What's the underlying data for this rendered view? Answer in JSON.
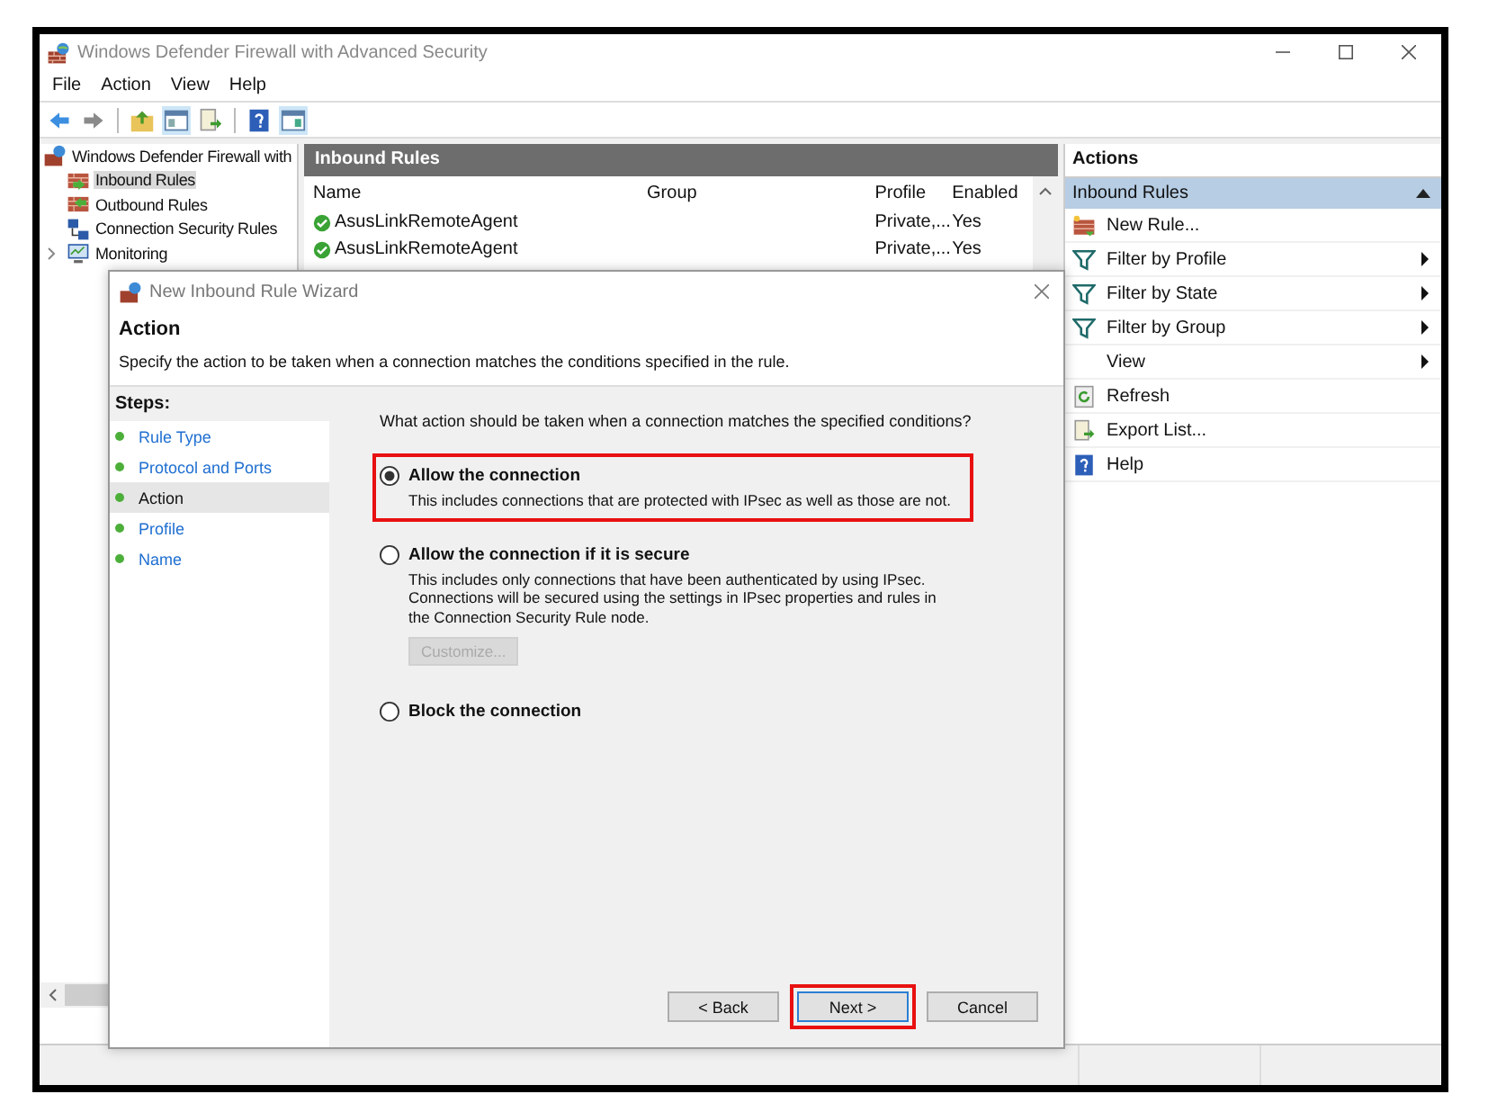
{
  "window": {
    "title": "Windows Defender Firewall with Advanced Security"
  },
  "menu": [
    "File",
    "Action",
    "View",
    "Help"
  ],
  "tree": {
    "label": "Windows Defender Firewall with",
    "children": [
      {
        "label": "Inbound Rules",
        "kind": "inbound",
        "selected": true
      },
      {
        "label": "Outbound Rules",
        "kind": "outbound",
        "selected": false
      },
      {
        "label": "Connection Security Rules",
        "kind": "security",
        "selected": false
      },
      {
        "label": "Monitoring",
        "kind": "monitor",
        "selected": false,
        "expanded": false
      }
    ]
  },
  "rules": {
    "title": "Inbound Rules",
    "columns": [
      "Name",
      "Group",
      "Profile",
      "Enabled"
    ],
    "rows": [
      {
        "name": "AsusLinkRemoteAgent",
        "profile": "Private,...",
        "enabled": "Yes"
      },
      {
        "name": "AsusLinkRemoteAgent",
        "profile": "Private,...",
        "enabled": "Yes"
      }
    ]
  },
  "actions": {
    "title": "Actions",
    "group": {
      "label": "Inbound Rules",
      "expanded": true
    },
    "items": [
      {
        "label": "New Rule...",
        "kind": "new-rule",
        "submenu": false
      },
      {
        "label": "Filter by Profile",
        "kind": "filter",
        "submenu": true
      },
      {
        "label": "Filter by State",
        "kind": "filter",
        "submenu": true
      },
      {
        "label": "Filter by Group",
        "kind": "filter",
        "submenu": true
      },
      {
        "label": "View",
        "kind": "none",
        "submenu": true
      },
      {
        "label": "Refresh",
        "kind": "refresh",
        "submenu": false
      },
      {
        "label": "Export List...",
        "kind": "export",
        "submenu": false
      },
      {
        "label": "Help",
        "kind": "help",
        "submenu": false
      }
    ]
  },
  "wizard": {
    "title": "New Inbound Rule Wizard",
    "heading": "Action",
    "description": "Specify the action to be taken when a connection matches the conditions specified in the rule.",
    "steps_label": "Steps:",
    "steps": [
      {
        "label": "Rule Type",
        "selected": false
      },
      {
        "label": "Protocol and Ports",
        "selected": false
      },
      {
        "label": "Action",
        "selected": true
      },
      {
        "label": "Profile",
        "selected": false
      },
      {
        "label": "Name",
        "selected": false
      }
    ],
    "question": "What action should be taken when a connection matches the specified conditions?",
    "options": [
      {
        "label": "Allow the connection",
        "description": "This includes connections that are protected with IPsec as well as those are not.",
        "selected": true,
        "highlighted": true
      },
      {
        "label": "Allow the connection if it is secure",
        "description": "This includes only connections that have been authenticated by using IPsec.  Connections will be secured using the settings in IPsec properties and rules in the Connection Security Rule node.",
        "selected": false,
        "highlighted": false,
        "button": {
          "label": "Customize...",
          "disabled": true
        }
      },
      {
        "label": "Block the connection",
        "selected": false,
        "highlighted": false
      }
    ],
    "buttons": [
      {
        "label": "< Back",
        "highlighted": false,
        "focused": false
      },
      {
        "label": "Next >",
        "highlighted": true,
        "focused": true
      },
      {
        "label": "Cancel",
        "highlighted": false,
        "focused": false
      }
    ]
  }
}
